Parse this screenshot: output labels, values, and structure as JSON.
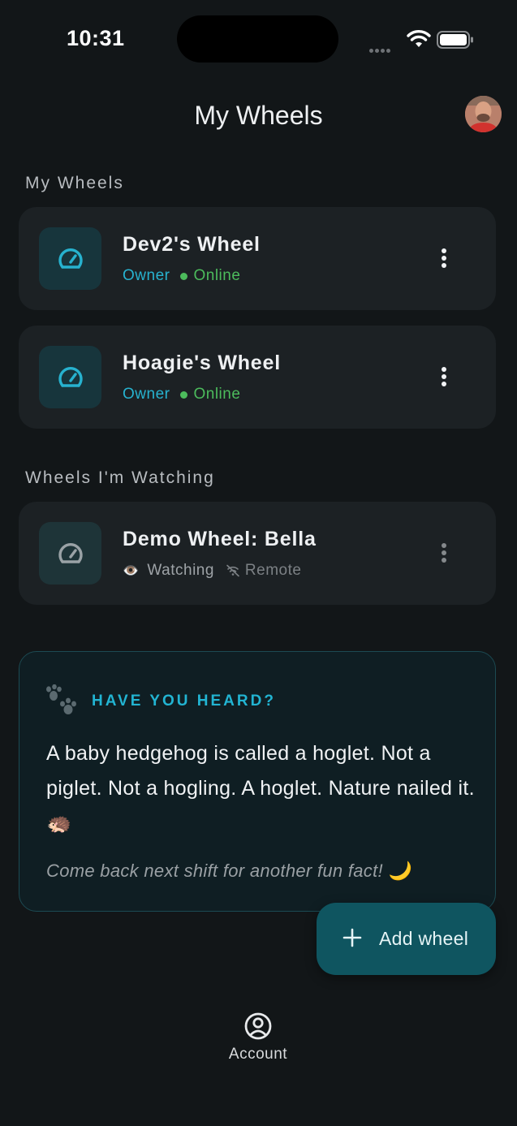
{
  "status_bar": {
    "time": "10:31"
  },
  "header": {
    "title": "My Wheels"
  },
  "sections": {
    "my_wheels": "My Wheels",
    "watching": "Wheels I'm Watching"
  },
  "my_wheels": [
    {
      "name": "Dev2's Wheel",
      "role": "Owner",
      "status": "Online"
    },
    {
      "name": "Hoagie's Wheel",
      "role": "Owner",
      "status": "Online"
    }
  ],
  "watched_wheels": [
    {
      "name": "Demo Wheel: Bella",
      "eye": "👁️",
      "role": "Watching",
      "status": "Remote"
    }
  ],
  "fun_fact": {
    "heading": "HAVE YOU HEARD?",
    "body": "A baby hedgehog is called a hoglet. Not a piglet. Not a hogling. A hoglet. Nature nailed it. 🦔",
    "footer": "Come back next shift for another fun fact! 🌙"
  },
  "fab": {
    "label": "Add wheel"
  },
  "bottom_nav": {
    "account_label": "Account"
  },
  "colors": {
    "background": "#121618",
    "card": "#1c2124",
    "accent": "#27b2cf",
    "online": "#4cbb5c",
    "fab": "#0f5560"
  },
  "icons": {
    "wheel": "speedometer-icon",
    "menu": "more-vertical-icon",
    "remote": "wifi-off-icon",
    "fact": "paw-icon",
    "add": "plus-icon",
    "account": "account-circle-icon"
  }
}
